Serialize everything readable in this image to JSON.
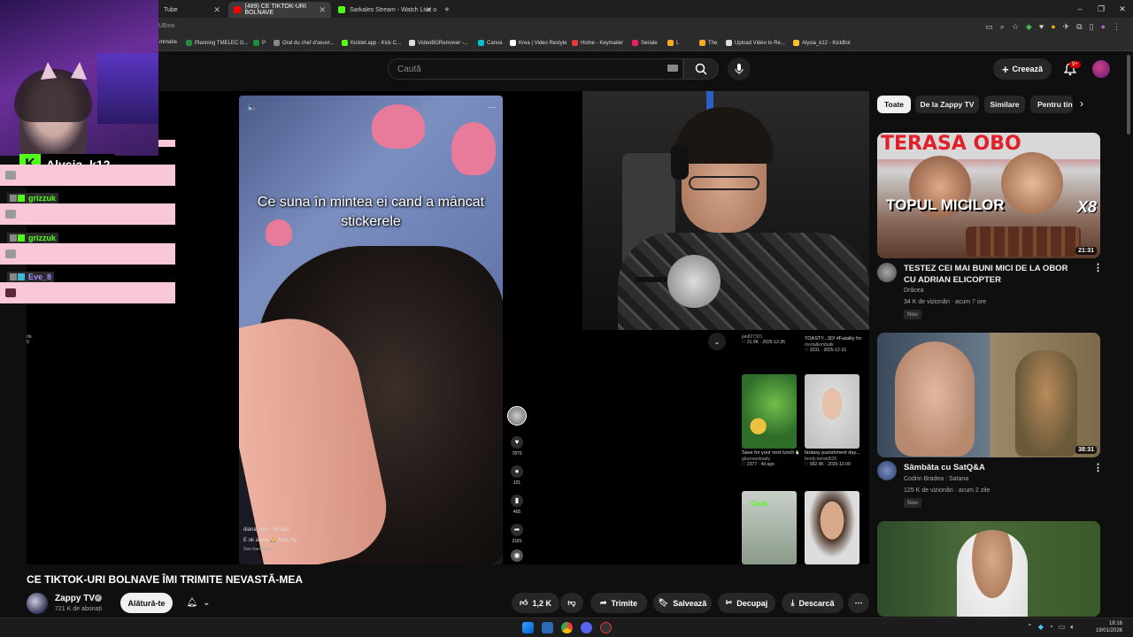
{
  "browser": {
    "tabs": [
      {
        "label": "Tube",
        "active": false
      },
      {
        "label": "(489) CE TIKTOK-URI BOLNAVE",
        "active": true
      },
      {
        "label": "Sarkales Stream - Watch Live o",
        "active": false
      }
    ],
    "new_tab": "+",
    "window_controls": {
      "minimize": "–",
      "maximize": "❐",
      "close": "✕"
    },
    "url": "UBxw",
    "bookmarks": [
      "mmaire",
      "Planning TMELEC G...",
      "P",
      "Oral du chef d'oeuvr...",
      "Kicklet.app - Kick C...",
      "VideoBGRemover -...",
      "Canva",
      "Krea | Video Restyle",
      "Home - Keymailer",
      "Seriale",
      "L",
      "The",
      "Upload Video to Re...",
      "Alysia_k12 - KickBot"
    ]
  },
  "header": {
    "search_placeholder": "Caută",
    "create_label": "Creează",
    "notif_count": "9+"
  },
  "overlay": {
    "streamer": "Alysia_k12",
    "kick_letter": "K",
    "chat": [
      {
        "user": "grizzuk"
      },
      {
        "user": "grizzuk"
      },
      {
        "user": "Eve_8"
      }
    ],
    "side_text_1": "rlo",
    "side_text_2": "0"
  },
  "tiktok": {
    "caption": "Ce suna în mintea ei cand a mâncat stickerele",
    "author": "diana_hpn · 5d ago",
    "desc": "E ok acum 🙏 #cat #fy",
    "translate": "See translation",
    "counts": [
      "7870",
      "101",
      "465",
      "2181"
    ],
    "grid": [
      {
        "caption": "",
        "author": "jan827321",
        "stat": "♡ 21.9K · 2025-12-26"
      },
      {
        "caption": "TOASTY...3D! #Fatality from...",
        "author": "mortalkombatk",
        "stat": "♡ 3231 · 2025-12-15"
      },
      {
        "caption": "Save for your next lunch 🥗 This is...",
        "author": "glucosestoady",
        "stat": "♡ 2377 · 4d ago"
      },
      {
        "caption": "fantasy punishment day...",
        "author": "brody.tarrant530",
        "stat": "♡ 992.9K · 2025-12-09"
      },
      {
        "caption": "Grok",
        "author": "",
        "stat": ""
      },
      {
        "caption": "",
        "author": "",
        "stat": ""
      }
    ]
  },
  "video": {
    "title": "CE TIKTOK-URI BOLNAVE ÎMI TRIMITE NEVASTĂ-MEA",
    "channel": "Zappy TV",
    "subscribers": "721 K de abonați",
    "join_label": "Alătură-te",
    "likes": "1,2 K",
    "share_label": "Trimite",
    "save_label": "Salvează",
    "clip_label": "Decupaj",
    "download_label": "Descarcă"
  },
  "chips": [
    {
      "label": "Toate",
      "active": true
    },
    {
      "label": "De la Zappy TV",
      "active": false
    },
    {
      "label": "Similare",
      "active": false
    },
    {
      "label": "Pentru tine",
      "active": false
    }
  ],
  "recommendations": [
    {
      "title": "TESTEZ CEI MAI BUNI MICI DE LA OBOR CU ADRIAN ELICOPTER",
      "channel": "Drăcea",
      "meta": "34 K de vizionări · acum 7 ore",
      "badge": "Nou",
      "duration": "21:31",
      "thumb_text_top": "TERASA OBO",
      "thumb_text_main": "TOPUL MICILOR",
      "thumb_text_x": "X8"
    },
    {
      "title": "Sâmbăta cu SatQ&A",
      "channel": "Codrin Bradea : Satana",
      "meta": "125 K de vizionări · acum 2 zile",
      "badge": "Nou",
      "duration": "38:31"
    }
  ],
  "taskbar": {
    "time": "18:16",
    "date": "19/01/2026"
  },
  "colors": {
    "background": "#0f0f0f",
    "kick_green": "#53fc18",
    "chat_pink": "#f8c8d8",
    "notif_red": "#cc0000"
  }
}
